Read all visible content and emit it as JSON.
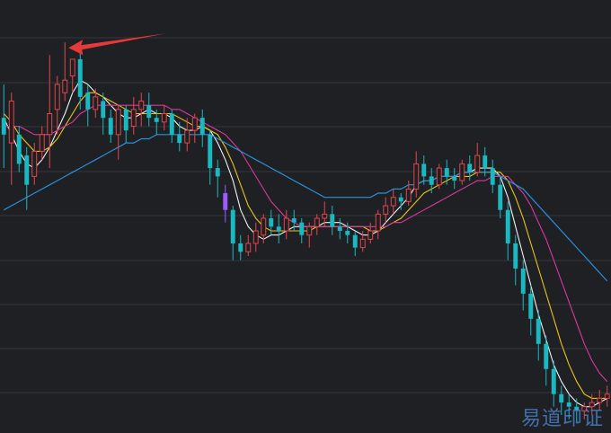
{
  "chart_data": {
    "type": "candlestick",
    "title": "",
    "xlabel": "",
    "ylabel": "",
    "grid": true,
    "ylim": [
      0,
      100
    ],
    "colors": {
      "background": "#1f2024",
      "grid": "#33363d",
      "up": "#e0484a",
      "down": "#1ab8c0",
      "highlight": "#9a5cff",
      "ma_fast": "#f2f2f2",
      "ma_mid": "#e8c41c",
      "ma_slow": "#d9399c",
      "ma_long": "#2b8fd6",
      "annotation_arrow": "#e63a3a"
    },
    "candles": [
      [
        74,
        70,
        82,
        62
      ],
      [
        68,
        78,
        80,
        58
      ],
      [
        70,
        63,
        72,
        61
      ],
      [
        65,
        58,
        67,
        52
      ],
      [
        60,
        66,
        68,
        58
      ],
      [
        66,
        70,
        72,
        64
      ],
      [
        70,
        75,
        89,
        62
      ],
      [
        76,
        82,
        84,
        70
      ],
      [
        80,
        83,
        92,
        78
      ],
      [
        84,
        88,
        86,
        80
      ],
      [
        88,
        79,
        90,
        76
      ],
      [
        80,
        76,
        82,
        72
      ],
      [
        76,
        79,
        81,
        74
      ],
      [
        78,
        74,
        80,
        70
      ],
      [
        74,
        70,
        76,
        68
      ],
      [
        70,
        76,
        77,
        64
      ],
      [
        76,
        71,
        77,
        68
      ],
      [
        72,
        76,
        79,
        70
      ],
      [
        76,
        78,
        80,
        72
      ],
      [
        77,
        74,
        80,
        72
      ],
      [
        74,
        73,
        76,
        70
      ],
      [
        73,
        75,
        77,
        71
      ],
      [
        75,
        70,
        76,
        68
      ],
      [
        70,
        68,
        73,
        66
      ],
      [
        68,
        71,
        74,
        66
      ],
      [
        71,
        74,
        75,
        68
      ],
      [
        74,
        70,
        76,
        67
      ],
      [
        70,
        62,
        71,
        58
      ],
      [
        62,
        60,
        64,
        55
      ],
      [
        56,
        52,
        58,
        49
      ],
      [
        52,
        44,
        53,
        40
      ],
      [
        44,
        42,
        46,
        40
      ],
      [
        42,
        44,
        46,
        41
      ],
      [
        44,
        47,
        49,
        42
      ],
      [
        46,
        50,
        51,
        44
      ],
      [
        50,
        48,
        52,
        46
      ],
      [
        48,
        47,
        51,
        44
      ],
      [
        47,
        50,
        52,
        45
      ],
      [
        50,
        49,
        52,
        47
      ],
      [
        49,
        46,
        50,
        44
      ],
      [
        46,
        48,
        49,
        43
      ],
      [
        48,
        50,
        51,
        46
      ],
      [
        50,
        51,
        54,
        48
      ],
      [
        51,
        48,
        53,
        46
      ],
      [
        48,
        47,
        50,
        45
      ],
      [
        47,
        46,
        49,
        44
      ],
      [
        46,
        43,
        47,
        41
      ],
      [
        43,
        45,
        47,
        42
      ],
      [
        45,
        47,
        49,
        44
      ],
      [
        47,
        51,
        52,
        45
      ],
      [
        51,
        53,
        55,
        49
      ],
      [
        53,
        55,
        57,
        51
      ],
      [
        55,
        54,
        56,
        52
      ],
      [
        54,
        57,
        59,
        53
      ],
      [
        57,
        63,
        66,
        55
      ],
      [
        63,
        60,
        65,
        58
      ],
      [
        60,
        58,
        62,
        56
      ],
      [
        58,
        62,
        63,
        57
      ],
      [
        62,
        60,
        64,
        58
      ],
      [
        60,
        59,
        62,
        57
      ],
      [
        59,
        63,
        64,
        58
      ],
      [
        63,
        61,
        65,
        59
      ],
      [
        61,
        65,
        68,
        60
      ],
      [
        65,
        62,
        67,
        60
      ],
      [
        62,
        58,
        64,
        56
      ],
      [
        58,
        52,
        60,
        50
      ],
      [
        52,
        44,
        54,
        40
      ],
      [
        44,
        38,
        46,
        34
      ],
      [
        38,
        32,
        40,
        28
      ],
      [
        32,
        26,
        34,
        22
      ],
      [
        26,
        20,
        28,
        16
      ],
      [
        20,
        14,
        22,
        10
      ],
      [
        14,
        8,
        16,
        5
      ],
      [
        8,
        6,
        10,
        3
      ],
      [
        6,
        5,
        8,
        2
      ],
      [
        5,
        4,
        7,
        1
      ],
      [
        4,
        5,
        6,
        2
      ],
      [
        5,
        6,
        8,
        3
      ],
      [
        6,
        7,
        9,
        4
      ],
      [
        7,
        8,
        10,
        5
      ]
    ],
    "ma": [
      {
        "id": "ma_fast",
        "values": [
          74,
          70,
          66,
          63,
          62,
          64,
          67,
          71,
          75,
          80,
          83,
          82,
          80,
          79,
          77,
          75,
          74,
          74,
          75,
          76,
          75,
          75,
          74,
          72,
          71,
          71,
          72,
          71,
          68,
          64,
          59,
          52,
          48,
          46,
          45,
          46,
          46,
          47,
          48,
          48,
          48,
          48,
          49,
          49,
          49,
          48,
          47,
          46,
          46,
          47,
          49,
          51,
          53,
          55,
          58,
          59,
          59,
          60,
          60,
          60,
          61,
          61,
          62,
          62,
          62,
          60,
          55,
          48,
          41,
          34,
          27,
          21,
          15,
          11,
          8,
          6,
          5,
          5,
          6,
          7
        ]
      },
      {
        "id": "ma_mid",
        "values": [
          75,
          73,
          70,
          68,
          66,
          66,
          67,
          69,
          72,
          75,
          78,
          80,
          80,
          79,
          78,
          77,
          76,
          75,
          75,
          75,
          75,
          75,
          75,
          74,
          73,
          72,
          72,
          71,
          70,
          67,
          63,
          58,
          53,
          50,
          48,
          47,
          47,
          47,
          47,
          47,
          47,
          48,
          48,
          48,
          48,
          48,
          48,
          48,
          47,
          47,
          48,
          49,
          50,
          52,
          54,
          56,
          57,
          58,
          59,
          60,
          60,
          60,
          61,
          61,
          61,
          61,
          59,
          55,
          50,
          44,
          38,
          32,
          26,
          20,
          15,
          11,
          8,
          7,
          7,
          7
        ]
      },
      {
        "id": "ma_slow",
        "values": [
          72,
          72,
          72,
          71,
          70,
          70,
          70,
          71,
          72,
          73,
          75,
          76,
          77,
          77,
          77,
          77,
          77,
          77,
          77,
          77,
          77,
          77,
          76,
          76,
          75,
          74,
          73,
          72,
          71,
          70,
          68,
          66,
          63,
          60,
          57,
          54,
          52,
          50,
          49,
          48,
          48,
          48,
          48,
          48,
          48,
          48,
          48,
          48,
          48,
          48,
          48,
          49,
          49,
          50,
          51,
          52,
          53,
          54,
          55,
          56,
          57,
          58,
          59,
          59,
          60,
          60,
          60,
          58,
          56,
          53,
          49,
          45,
          40,
          35,
          30,
          25,
          20,
          16,
          13,
          11
        ]
      },
      {
        "id": "ma_long",
        "values": [
          52,
          53,
          54,
          55,
          56,
          57,
          58,
          59,
          60,
          61,
          62,
          63,
          64,
          65,
          66,
          67,
          68,
          68,
          69,
          69,
          70,
          70,
          70,
          70,
          70,
          70,
          70,
          70,
          69,
          68,
          67,
          66,
          65,
          64,
          63,
          62,
          61,
          60,
          59,
          58,
          57,
          56,
          55,
          55,
          55,
          55,
          55,
          55,
          55,
          56,
          56,
          57,
          57,
          58,
          58,
          59,
          59,
          60,
          60,
          60,
          61,
          61,
          61,
          61,
          61,
          60,
          59,
          58,
          57,
          55,
          53,
          51,
          49,
          47,
          45,
          43,
          41,
          39,
          37,
          35
        ]
      }
    ],
    "annotation": {
      "type": "arrow",
      "target_candle": 8
    }
  },
  "watermark": "易道印证"
}
